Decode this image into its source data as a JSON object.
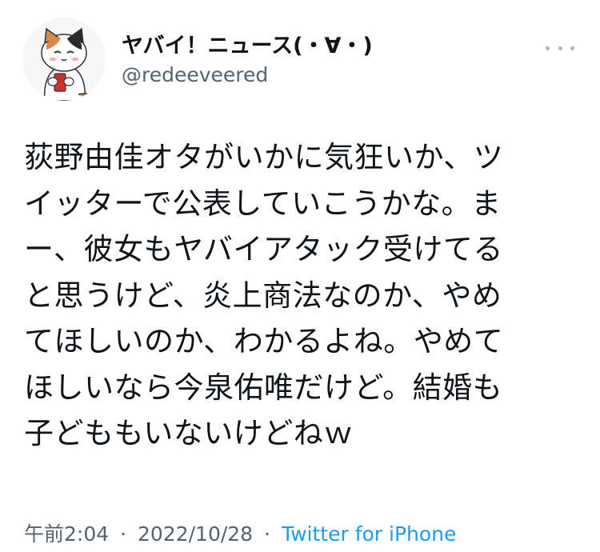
{
  "author": {
    "display_name": "ヤバイ！ニュース(・∀・)",
    "handle": "@redeeveered",
    "avatar_icon": "calico-cat-avatar-icon"
  },
  "more_icon": "more-horizontal-icon",
  "tweet": {
    "lines": [
      "荻野由佳オタがいかに気狂いか、ツ",
      "イッターで公表していこうかな。ま",
      "ー、彼女もヤバイアタック受けてる",
      "と思うけど、炎上商法なのか、やめ",
      "てほしいのか、わかるよね。やめて",
      "ほしいなら今泉佑唯だけど。結婚も",
      "子どももいないけどねｗ"
    ]
  },
  "meta": {
    "time": "午前2:04",
    "separator": "·",
    "date": "2022/10/28",
    "source": "Twitter for iPhone"
  },
  "colors": {
    "text": "#0f1419",
    "secondary": "#536471",
    "link": "#1d9bf0"
  }
}
